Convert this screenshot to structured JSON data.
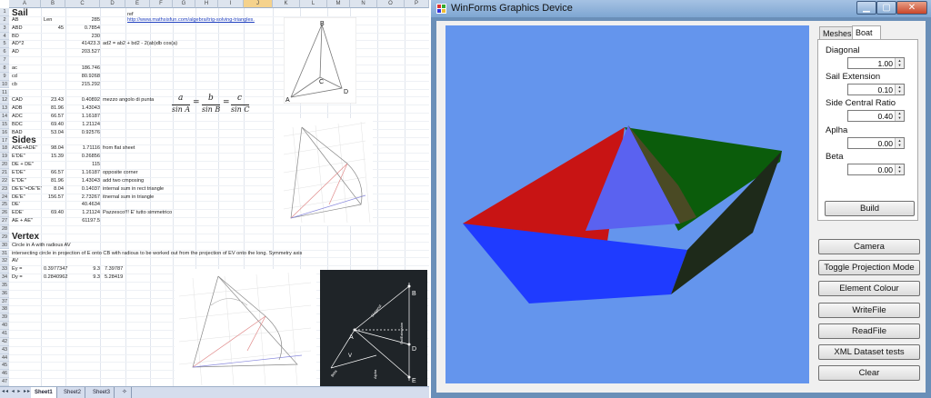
{
  "excel": {
    "columns": [
      "A",
      "B",
      "C",
      "D",
      "E",
      "F",
      "G",
      "H",
      "I",
      "J",
      "K",
      "L",
      "M",
      "N",
      "O",
      "P"
    ],
    "rows": [
      "1",
      "2",
      "3",
      "4",
      "5",
      "6",
      "7",
      "8",
      "9",
      "10",
      "11",
      "12",
      "13",
      "14",
      "15",
      "16",
      "17",
      "18",
      "19",
      "20",
      "21",
      "22",
      "23",
      "24",
      "25",
      "26",
      "27",
      "28",
      "29",
      "30",
      "31",
      "32",
      "33",
      "34",
      "35",
      "36",
      "37",
      "38",
      "39",
      "40",
      "41",
      "42",
      "43",
      "44",
      "45",
      "46",
      "47"
    ],
    "cells": {
      "r1a": "Sail",
      "r1e": "ref",
      "r2a": "AB",
      "r2b": "Len",
      "r2c": "285",
      "r2e": "http://www.mathsisfun.com/algebra/trig-solving-triangles.",
      "r3a": "ABD",
      "r3b": "45",
      "r3c": "0.7854",
      "r4a": "BD",
      "r4c": "230",
      "r5a": "AD^2",
      "r5c": "41423.3",
      "r5d": "ad2 = ab2 + bd2 - 2(ab)db cos(a)",
      "r6a": "AD",
      "r6c": "203.527",
      "r8a": "ac",
      "r8c": "186.746",
      "r9a": "cd",
      "r9c": "80.9268",
      "r10a": "cb",
      "r10c": "215.292",
      "r12a": "CAD",
      "r12b": "23.43",
      "r12c": "0.40892",
      "r12d": "mezzo angolo di punta",
      "r13a": "ADB",
      "r13b": "81.96",
      "r13c": "1.43043",
      "r14a": "ADC",
      "r14b": "66.57",
      "r14c": "1.16187",
      "r15a": "BDC",
      "r15b": "69.40",
      "r15c": "1.21124",
      "r16a": "BAD",
      "r16b": "53.04",
      "r16c": "0.92576",
      "r17a": "Sides",
      "r18a": "ADE+ADE''",
      "r18b": "98.04",
      "r18c": "1.71116",
      "r18d": "from flat sheet",
      "r19a": "E'DE''",
      "r19b": "15.39",
      "r19c": "0.26856",
      "r20a": "DE + DE''",
      "r20c": "115",
      "r21a": "E'DE''",
      "r21b": "66.57",
      "r21c": "1.16187",
      "r21d": "opposite corner",
      "r22a": "E''DE''",
      "r22b": "81.96",
      "r22c": "1.43043",
      "r22d": "add two cmposing",
      "r23a": "DE'E''=DE''E'",
      "r23b": "8.04",
      "r23c": "0.14037",
      "r23d": "internal sum in rect triangle",
      "r24a": "DE'E''",
      "r24b": "156.57",
      "r24c": "2.73267",
      "r24d": "itnernal sum in triangle",
      "r25a": "DE'",
      "r25c": "40.4634",
      "r26a": "EDE'",
      "r26b": "69.40",
      "r26c": "1.21124",
      "r26d": "Pazzesco!!! E' tutto simmetrico",
      "r27a": "AE + AE''",
      "r27c": "61197.5",
      "r29a": "Vertex",
      "r30a": "Circle in A with radious AV",
      "r31a": "intersecting circle in projection of E onto CB with radious to be worked out from the projection of EV onto the long. Symmetry axis",
      "r32a": "AV",
      "r33a": "Ey =",
      "r33b": "0.3977347",
      "r33c": "9.3",
      "r33d": "7.39787",
      "r34a": "Dy =",
      "r34b": "0.2840962",
      "r34c": "9.3",
      "r34d": "5.28419"
    },
    "formula_parts": [
      "a",
      "sin A",
      "b",
      "sin B",
      "c",
      "sin C"
    ],
    "diagram_labels": {
      "b": "B",
      "a": "A",
      "c": "C",
      "d": "D",
      "dark_b": "B",
      "dark_a": "A",
      "dark_v": "V",
      "dark_d": "D",
      "dark_e": "E",
      "dark_diag": "Diagonal",
      "dark_sail": "SailExtension",
      "dark_beta": "Beta",
      "dark_alpha": "Alpha"
    },
    "sheet_tabs": [
      "Sheet1",
      "Sheet2",
      "Sheet3"
    ],
    "active_sheet": "Sheet1"
  },
  "window": {
    "title": "WinForms Graphics Device",
    "tabs": [
      "Meshes",
      "Boat"
    ],
    "active_tab": "Boat",
    "params": [
      {
        "label": "Diagonal",
        "value": "1.00"
      },
      {
        "label": "Sail Extension",
        "value": "0.10"
      },
      {
        "label": "Side Central Ratio",
        "value": "0.40"
      },
      {
        "label": "Aplha",
        "value": "0.00"
      },
      {
        "label": "Beta",
        "value": "0.00"
      }
    ],
    "build_label": "Build",
    "buttons": [
      "Camera",
      "Toggle Projection Mode",
      "Element Colour",
      "WriteFile",
      "ReadFile",
      "XML Dataset tests",
      "Clear"
    ],
    "viewport_color": "#6495ed",
    "boat_colors": {
      "front": "#1f3bff",
      "red": "#c81414",
      "green": "#0b5c0b",
      "sail_left": "#5a62f0",
      "sail_right": "#4a4a24",
      "stern": "#1e2a1a"
    }
  }
}
